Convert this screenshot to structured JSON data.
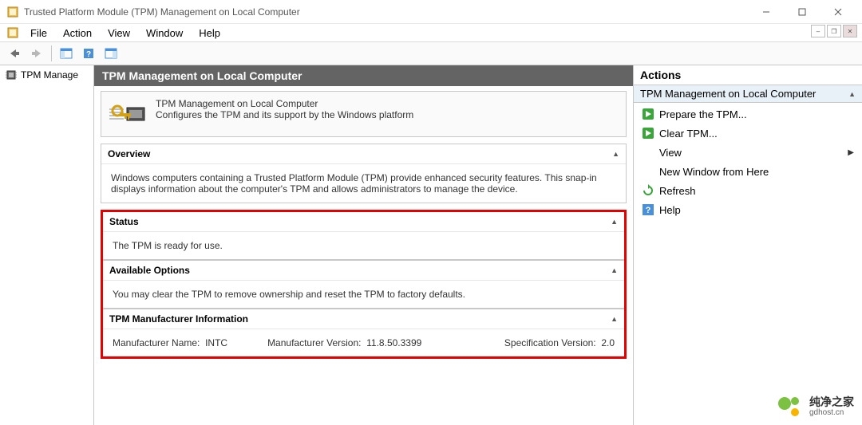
{
  "window": {
    "title": "Trusted Platform Module (TPM) Management on Local Computer"
  },
  "menubar": {
    "items": [
      "File",
      "Action",
      "View",
      "Window",
      "Help"
    ]
  },
  "tree": {
    "item_label": "TPM Manage"
  },
  "center": {
    "header": "TPM Management on Local Computer",
    "intro": {
      "line1": "TPM Management on Local Computer",
      "line2": "Configures the TPM and its support by the Windows platform"
    },
    "overview": {
      "title": "Overview",
      "body": "Windows computers containing a Trusted Platform Module (TPM) provide enhanced security features. This snap-in displays information about the computer's TPM and allows administrators to manage the device."
    },
    "status": {
      "title": "Status",
      "body": "The TPM is ready for use."
    },
    "available": {
      "title": "Available Options",
      "body": "You may clear the TPM to remove ownership and reset the TPM to factory defaults."
    },
    "mfr": {
      "title": "TPM Manufacturer Information",
      "name_label": "Manufacturer Name:",
      "name_value": "INTC",
      "version_label": "Manufacturer Version:",
      "version_value": "11.8.50.3399",
      "spec_label": "Specification Version:",
      "spec_value": "2.0"
    }
  },
  "actions": {
    "header": "Actions",
    "subheader": "TPM Management on Local Computer",
    "items": [
      {
        "label": "Prepare the TPM...",
        "icon": "go"
      },
      {
        "label": "Clear TPM...",
        "icon": "go"
      },
      {
        "label": "View",
        "icon": "none",
        "submenu": true
      },
      {
        "label": "New Window from Here",
        "icon": "none"
      },
      {
        "label": "Refresh",
        "icon": "refresh"
      },
      {
        "label": "Help",
        "icon": "help"
      }
    ]
  },
  "watermark": {
    "cn": "纯净之家",
    "url": "gdhost.cn"
  }
}
